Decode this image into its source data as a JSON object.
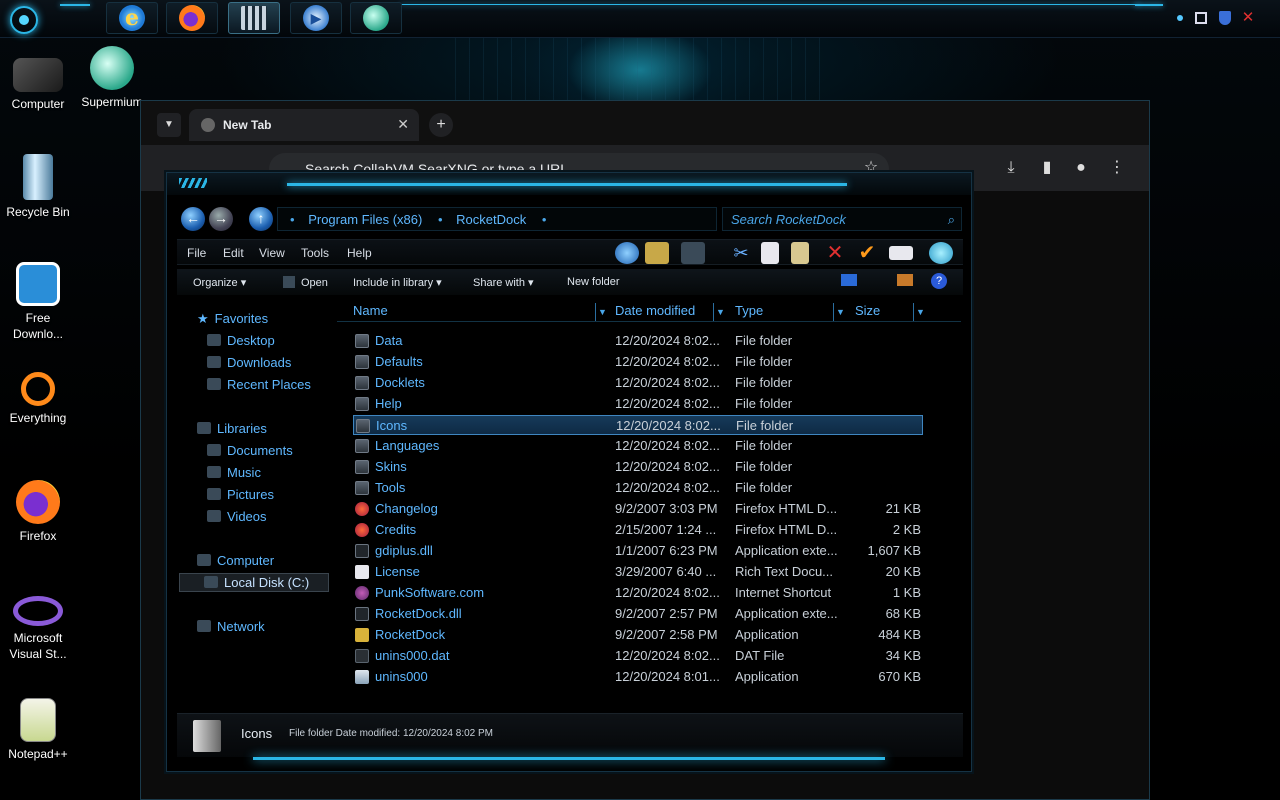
{
  "taskbar": {
    "apps": [
      {
        "name": "Internet Explorer",
        "icon": "ie-icon"
      },
      {
        "name": "Firefox",
        "icon": "firefox-icon"
      },
      {
        "name": "Explorer windows",
        "icon": "windows-icon",
        "active": true
      },
      {
        "name": "Media Player",
        "icon": "media-player-icon"
      },
      {
        "name": "Supermium",
        "icon": "supermium-icon"
      }
    ]
  },
  "desktop": {
    "icons": [
      {
        "label": "Computer",
        "icon": "computer-icon"
      },
      {
        "label": "Supermium",
        "icon": "supermium-icon"
      },
      {
        "label": "Recycle Bin",
        "icon": "recycle-bin-icon"
      },
      {
        "label": "Free Downlo...",
        "icon": "free-download-icon"
      },
      {
        "label": "Everything",
        "icon": "everything-icon"
      },
      {
        "label": "Firefox",
        "icon": "firefox-icon"
      },
      {
        "label": "Microsoft Visual St...",
        "icon": "visual-studio-icon"
      },
      {
        "label": "Notepad++",
        "icon": "notepadpp-icon"
      }
    ]
  },
  "browser": {
    "tab_title": "New Tab",
    "tab_close": "✕",
    "new_tab": "+",
    "omnibox_placeholder": "Search CollabVM SearXNG or type a URL"
  },
  "explorer": {
    "breadcrumb": [
      "Program Files (x86)",
      "RocketDock"
    ],
    "search_placeholder": "Search RocketDock",
    "menu": [
      "File",
      "Edit",
      "View",
      "Tools",
      "Help"
    ],
    "commands": [
      "Organize ▾",
      "Open",
      "Include in library ▾",
      "Share with ▾",
      "New folder"
    ],
    "nav": {
      "favorites": "Favorites",
      "favorites_items": [
        "Desktop",
        "Downloads",
        "Recent Places"
      ],
      "libraries": "Libraries",
      "libraries_items": [
        "Documents",
        "Music",
        "Pictures",
        "Videos"
      ],
      "computer": "Computer",
      "computer_items": [
        "Local Disk (C:)"
      ],
      "network": "Network"
    },
    "columns": [
      "Name",
      "Date modified",
      "Type",
      "Size"
    ],
    "files": [
      {
        "name": "Data",
        "date": "12/20/2024 8:02...",
        "type": "File folder",
        "size": "",
        "icon": "folder"
      },
      {
        "name": "Defaults",
        "date": "12/20/2024 8:02...",
        "type": "File folder",
        "size": "",
        "icon": "folder"
      },
      {
        "name": "Docklets",
        "date": "12/20/2024 8:02...",
        "type": "File folder",
        "size": "",
        "icon": "folder"
      },
      {
        "name": "Help",
        "date": "12/20/2024 8:02...",
        "type": "File folder",
        "size": "",
        "icon": "folder"
      },
      {
        "name": "Icons",
        "date": "12/20/2024 8:02...",
        "type": "File folder",
        "size": "",
        "icon": "folder",
        "selected": true
      },
      {
        "name": "Languages",
        "date": "12/20/2024 8:02...",
        "type": "File folder",
        "size": "",
        "icon": "folder"
      },
      {
        "name": "Skins",
        "date": "12/20/2024 8:02...",
        "type": "File folder",
        "size": "",
        "icon": "folder"
      },
      {
        "name": "Tools",
        "date": "12/20/2024 8:02...",
        "type": "File folder",
        "size": "",
        "icon": "folder"
      },
      {
        "name": "Changelog",
        "date": "9/2/2007 3:03 PM",
        "type": "Firefox HTML D...",
        "size": "21 KB",
        "icon": "ff"
      },
      {
        "name": "Credits",
        "date": "2/15/2007 1:24 ...",
        "type": "Firefox HTML D...",
        "size": "2 KB",
        "icon": "ff"
      },
      {
        "name": "gdiplus.dll",
        "date": "1/1/2007 6:23 PM",
        "type": "Application exte...",
        "size": "1,607 KB",
        "icon": "dll"
      },
      {
        "name": "License",
        "date": "3/29/2007 6:40 ...",
        "type": "Rich Text Docu...",
        "size": "20 KB",
        "icon": "doc"
      },
      {
        "name": "PunkSoftware.com",
        "date": "12/20/2024 8:02...",
        "type": "Internet Shortcut",
        "size": "1 KB",
        "icon": "url"
      },
      {
        "name": "RocketDock.dll",
        "date": "9/2/2007 2:57 PM",
        "type": "Application exte...",
        "size": "68 KB",
        "icon": "dll"
      },
      {
        "name": "RocketDock",
        "date": "9/2/2007 2:58 PM",
        "type": "Application",
        "size": "484 KB",
        "icon": "app"
      },
      {
        "name": "unins000.dat",
        "date": "12/20/2024 8:02...",
        "type": "DAT File",
        "size": "34 KB",
        "icon": "dat"
      },
      {
        "name": "unins000",
        "date": "12/20/2024 8:01...",
        "type": "Application",
        "size": "670 KB",
        "icon": "inst"
      }
    ],
    "details": {
      "name": "Icons",
      "meta": "File folder  Date modified:  12/20/2024 8:02 PM"
    }
  }
}
